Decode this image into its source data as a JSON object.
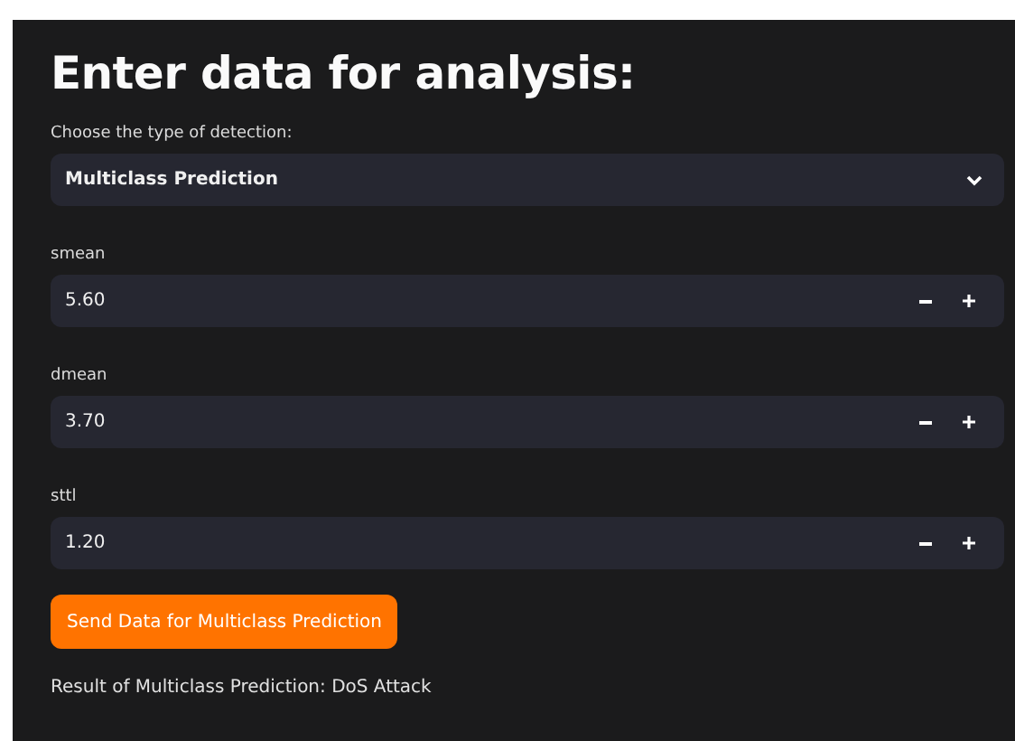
{
  "title": "Enter data for analysis:",
  "detection": {
    "label": "Choose the type of detection:",
    "value": "Multiclass Prediction"
  },
  "inputs": [
    {
      "label": "smean",
      "value": "5.60"
    },
    {
      "label": "dmean",
      "value": "3.70"
    },
    {
      "label": "sttl",
      "value": "1.20"
    }
  ],
  "submit_button": "Send Data for Multiclass Prediction",
  "result": "Result of Multiclass Prediction: DoS Attack"
}
